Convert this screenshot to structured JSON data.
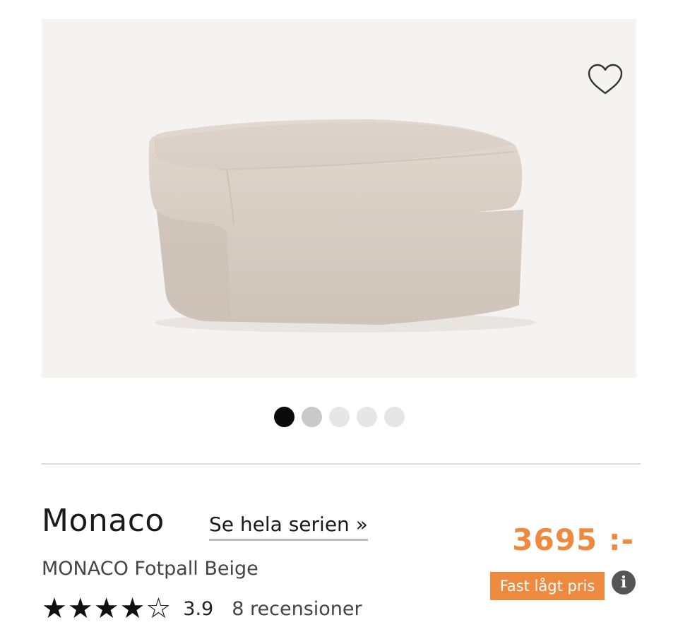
{
  "product": {
    "series_name": "Monaco",
    "series_link_label": "Se hela serien »",
    "full_name": "MONACO Fotpall Beige",
    "price": "3695 :-",
    "price_badge": "Fast lågt pris",
    "info_symbol": "i",
    "rating": {
      "value": "3.9",
      "stars_filled": 4,
      "stars_total": 5,
      "star_symbols": [
        "★",
        "★",
        "★",
        "★",
        "☆"
      ],
      "reviews_label": "8 recensioner"
    }
  },
  "gallery": {
    "image_count": 5,
    "active_index": 0,
    "image_alt": "Beige fotpall med lös dyna",
    "wishlist_icon": "heart-outline-icon"
  },
  "colors": {
    "accent": "#ee8a40",
    "image_background": "#f5f3f1",
    "active_dot": "#0a0a0a",
    "inactive_dot": "#e6e6e6"
  }
}
